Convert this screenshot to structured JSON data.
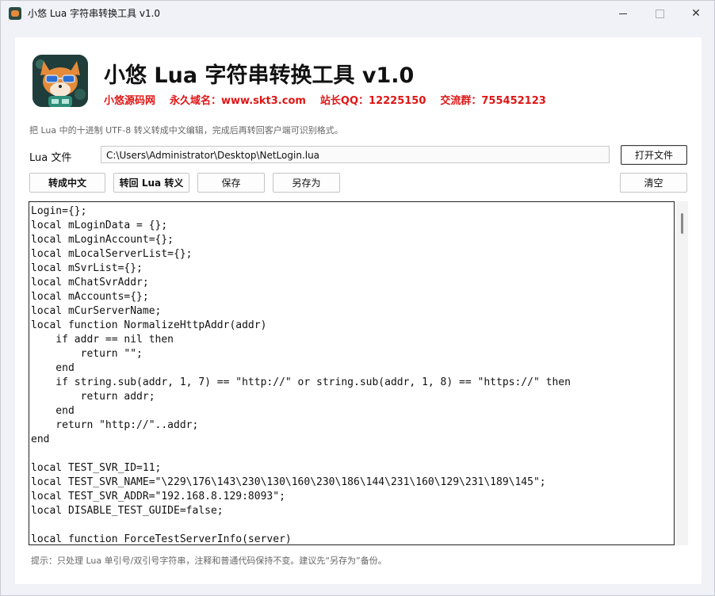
{
  "window": {
    "title": "小悠 Lua 字符串转换工具 v1.0",
    "controls": {
      "minimize": "minimize",
      "maximize": "maximize",
      "close": "✕"
    }
  },
  "header": {
    "title": "小悠 Lua 字符串转换工具 v1.0",
    "links": [
      "小悠源码网",
      "永久域名：www.skt3.com",
      "站长QQ：12225150",
      "交流群：755452123"
    ],
    "accent_color": "#e01515"
  },
  "description": "把 Lua 中的十进制 UTF-8 转义转成中文编辑，完成后再转回客户端可识别格式。",
  "file": {
    "label": "Lua 文件",
    "path": "C:\\Users\\Administrator\\Desktop\\NetLogin.lua",
    "open_button": "打开文件"
  },
  "toolbar": {
    "to_chinese": "转成中文",
    "to_lua_escape": "转回 Lua 转义",
    "save": "保存",
    "save_as": "另存为",
    "clear": "清空"
  },
  "editor": {
    "lines": [
      "Login={};",
      "local mLoginData = {};",
      "local mLoginAccount={};",
      "local mLocalServerList={};",
      "local mSvrList={};",
      "local mChatSvrAddr;",
      "local mAccounts={};",
      "local mCurServerName;",
      "local function NormalizeHttpAddr(addr)",
      "    if addr == nil then",
      "        return \"\";",
      "    end",
      "    if string.sub(addr, 1, 7) == \"http://\" or string.sub(addr, 1, 8) == \"https://\" then",
      "        return addr;",
      "    end",
      "    return \"http://\"..addr;",
      "end",
      "",
      "local TEST_SVR_ID=11;",
      "local TEST_SVR_NAME=\"\\229\\176\\143\\230\\130\\160\\230\\186\\144\\231\\160\\129\\231\\189\\145\";",
      "local TEST_SVR_ADDR=\"192.168.8.129:8093\";",
      "local DISABLE_TEST_GUIDE=false;",
      "",
      "local function ForceTestServerInfo(server)"
    ]
  },
  "hint": "提示：只处理 Lua 单引号/双引号字符串，注释和普通代码保持不变。建议先“另存为”备份。"
}
